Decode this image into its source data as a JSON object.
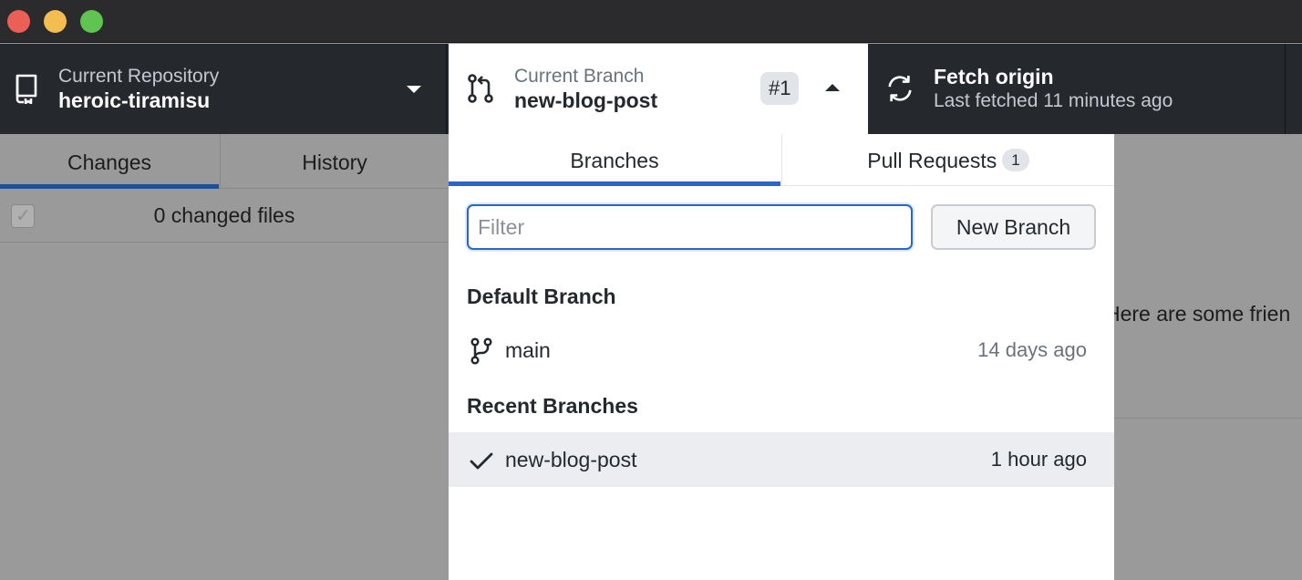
{
  "toolbar": {
    "repository": {
      "label": "Current Repository",
      "value": "heroic-tiramisu"
    },
    "branch": {
      "label": "Current Branch",
      "value": "new-blog-post",
      "pr_badge": "#1"
    },
    "fetch": {
      "label": "Fetch origin",
      "status": "Last fetched 11 minutes ago"
    }
  },
  "left_pane": {
    "tabs": [
      {
        "label": "Changes",
        "selected": true
      },
      {
        "label": "History",
        "selected": false
      }
    ],
    "changed_files": "0 changed files"
  },
  "right_pane": {
    "text": "Here are some frien"
  },
  "dropdown": {
    "tabs": {
      "branches": "Branches",
      "pull_requests": "Pull Requests",
      "pull_requests_count": "1"
    },
    "filter": {
      "placeholder": "Filter",
      "value": ""
    },
    "new_branch_label": "New Branch",
    "default_section": "Default Branch",
    "default_branch": {
      "name": "main",
      "time": "14 days ago",
      "icon": "git-branch-icon"
    },
    "recent_section": "Recent Branches",
    "recent_branches": [
      {
        "name": "new-blog-post",
        "time": "1 hour ago",
        "icon": "check-icon",
        "selected": true
      }
    ]
  },
  "colors": {
    "accent": "#2a66c8",
    "toolbar_bg": "#25282d",
    "overlay": "#9a9a9a"
  }
}
